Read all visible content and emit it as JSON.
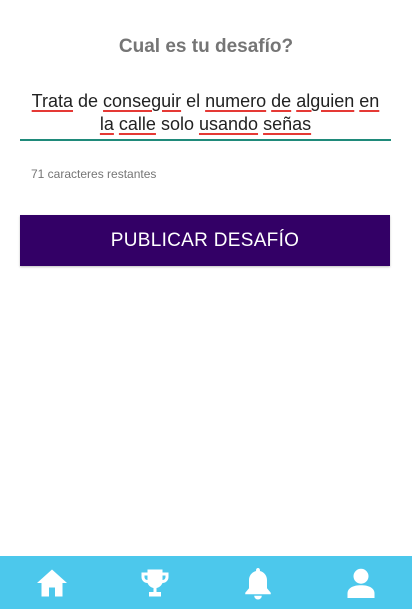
{
  "header": {
    "title": "Cual es tu desafío?"
  },
  "challenge": {
    "line1": [
      {
        "t": "Trata",
        "sp": true
      },
      {
        "t": " de ",
        "sp": false
      },
      {
        "t": "conseguir",
        "sp": true
      },
      {
        "t": " el ",
        "sp": false
      },
      {
        "t": "numero",
        "sp": true
      },
      {
        "t": " ",
        "sp": false
      },
      {
        "t": "de",
        "sp": true
      },
      {
        "t": " ",
        "sp": false
      },
      {
        "t": "alguien",
        "sp": true
      },
      {
        "t": " ",
        "sp": false
      },
      {
        "t": "en",
        "sp": true
      }
    ],
    "line2": [
      {
        "t": "la",
        "sp": true
      },
      {
        "t": " ",
        "sp": false
      },
      {
        "t": "calle",
        "sp": true
      },
      {
        "t": " solo ",
        "sp": false
      },
      {
        "t": "usando",
        "sp": true
      },
      {
        "t": " ",
        "sp": false
      },
      {
        "t": "señas",
        "sp": true
      }
    ],
    "remaining_label": "71 caracteres restantes",
    "accent_color": "#1f8a7a",
    "spellcheck_color": "#e53935"
  },
  "actions": {
    "publish_label": "PUBLICAR DESAFÍO",
    "publish_color": "#330066"
  },
  "bottom_nav": {
    "background": "#4cc8ec",
    "items": [
      {
        "icon": "home-icon"
      },
      {
        "icon": "trophy-icon"
      },
      {
        "icon": "bell-icon"
      },
      {
        "icon": "user-icon"
      }
    ]
  }
}
